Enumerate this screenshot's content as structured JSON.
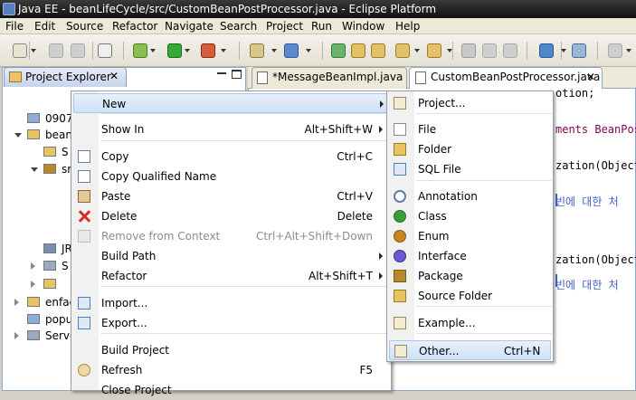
{
  "window": {
    "title": "Java EE - beanLifeCycle/src/CustomBeanPostProcessor.java - Eclipse Platform"
  },
  "menubar": [
    {
      "label": "File",
      "id": "file"
    },
    {
      "label": "Edit",
      "id": "edit"
    },
    {
      "label": "Source",
      "id": "source"
    },
    {
      "label": "Refactor",
      "id": "refactor"
    },
    {
      "label": "Navigate",
      "id": "navigate"
    },
    {
      "label": "Search",
      "id": "search"
    },
    {
      "label": "Project",
      "id": "project"
    },
    {
      "label": "Run",
      "id": "run"
    },
    {
      "label": "Window",
      "id": "window"
    },
    {
      "label": "Help",
      "id": "help"
    }
  ],
  "project_explorer": {
    "tab_label": "Project Explorer",
    "close": "✕",
    "items": [
      "0907",
      "bean",
      "S",
      "sr",
      "JR",
      "S",
      "enfac",
      "popu",
      "Serve"
    ]
  },
  "editor": {
    "tabs": [
      {
        "label": "*MessageBeanImpl.java"
      },
      {
        "label": "CustomBeanPostProcessor.java"
      }
    ],
    "close": "✕",
    "code_lines": [
      "otion;",
      "ments BeanPost",
      "zation(Object",
      "빈에 대한 처",
      "zation(Object",
      "빈에 대한 처"
    ]
  },
  "context_menu": {
    "items": [
      {
        "label": "New",
        "shortcut": "",
        "submenu": true,
        "icon": "none",
        "selected": true,
        "disabled": false
      },
      {
        "label": "Show In",
        "shortcut": "Alt+Shift+W",
        "submenu": true,
        "icon": "none",
        "selected": false,
        "disabled": false
      },
      {
        "label": "Copy",
        "shortcut": "Ctrl+C",
        "submenu": false,
        "icon": "copy-icon",
        "selected": false,
        "disabled": false
      },
      {
        "label": "Copy Qualified Name",
        "shortcut": "",
        "submenu": false,
        "icon": "copy-qualified-name-icon",
        "selected": false,
        "disabled": false
      },
      {
        "label": "Paste",
        "shortcut": "Ctrl+V",
        "submenu": false,
        "icon": "paste-icon",
        "selected": false,
        "disabled": false
      },
      {
        "label": "Delete",
        "shortcut": "Delete",
        "submenu": false,
        "icon": "delete-icon",
        "selected": false,
        "disabled": false
      },
      {
        "label": "Remove from Context",
        "shortcut": "Ctrl+Alt+Shift+Down",
        "submenu": false,
        "icon": "remove-from-context-icon",
        "selected": false,
        "disabled": true
      },
      {
        "label": "Build Path",
        "shortcut": "",
        "submenu": true,
        "icon": "none",
        "selected": false,
        "disabled": false
      },
      {
        "label": "Refactor",
        "shortcut": "Alt+Shift+T",
        "submenu": true,
        "icon": "none",
        "selected": false,
        "disabled": false
      },
      {
        "label": "Import...",
        "shortcut": "",
        "submenu": false,
        "icon": "import-icon",
        "selected": false,
        "disabled": false
      },
      {
        "label": "Export...",
        "shortcut": "",
        "submenu": false,
        "icon": "export-icon",
        "selected": false,
        "disabled": false
      },
      {
        "label": "Build Project",
        "shortcut": "",
        "submenu": false,
        "icon": "none",
        "selected": false,
        "disabled": false
      },
      {
        "label": "Refresh",
        "shortcut": "F5",
        "submenu": false,
        "icon": "refresh-icon",
        "selected": false,
        "disabled": false
      },
      {
        "label": "Close Project",
        "shortcut": "",
        "submenu": false,
        "icon": "none",
        "selected": false,
        "disabled": false
      }
    ]
  },
  "new_submenu": {
    "items": [
      {
        "label": "Project...",
        "shortcut": "",
        "icon": "new-project-icon",
        "selected": false
      },
      {
        "label": "File",
        "shortcut": "",
        "icon": "file-icon",
        "selected": false
      },
      {
        "label": "Folder",
        "shortcut": "",
        "icon": "folder-icon",
        "selected": false
      },
      {
        "label": "SQL File",
        "shortcut": "",
        "icon": "sql-file-icon",
        "selected": false
      },
      {
        "label": "Annotation",
        "shortcut": "",
        "icon": "annotation-icon",
        "selected": false
      },
      {
        "label": "Class",
        "shortcut": "",
        "icon": "class-icon",
        "selected": false
      },
      {
        "label": "Enum",
        "shortcut": "",
        "icon": "enum-icon",
        "selected": false
      },
      {
        "label": "Interface",
        "shortcut": "",
        "icon": "interface-icon",
        "selected": false
      },
      {
        "label": "Package",
        "shortcut": "",
        "icon": "package-icon",
        "selected": false
      },
      {
        "label": "Source Folder",
        "shortcut": "",
        "icon": "source-folder-icon",
        "selected": false
      },
      {
        "label": "Example...",
        "shortcut": "",
        "icon": "example-icon",
        "selected": false
      },
      {
        "label": "Other...",
        "shortcut": "Ctrl+N",
        "icon": "other-icon",
        "selected": true
      }
    ]
  },
  "colors": {
    "selection": "#cfe0f7",
    "delete": "#d62b2b",
    "class": "#3c9b3c",
    "interface": "#6a5acd",
    "annotation": "#5b7fa8",
    "enum": "#c7851f",
    "package": "#b5892c",
    "folder": "#e8c35f"
  }
}
